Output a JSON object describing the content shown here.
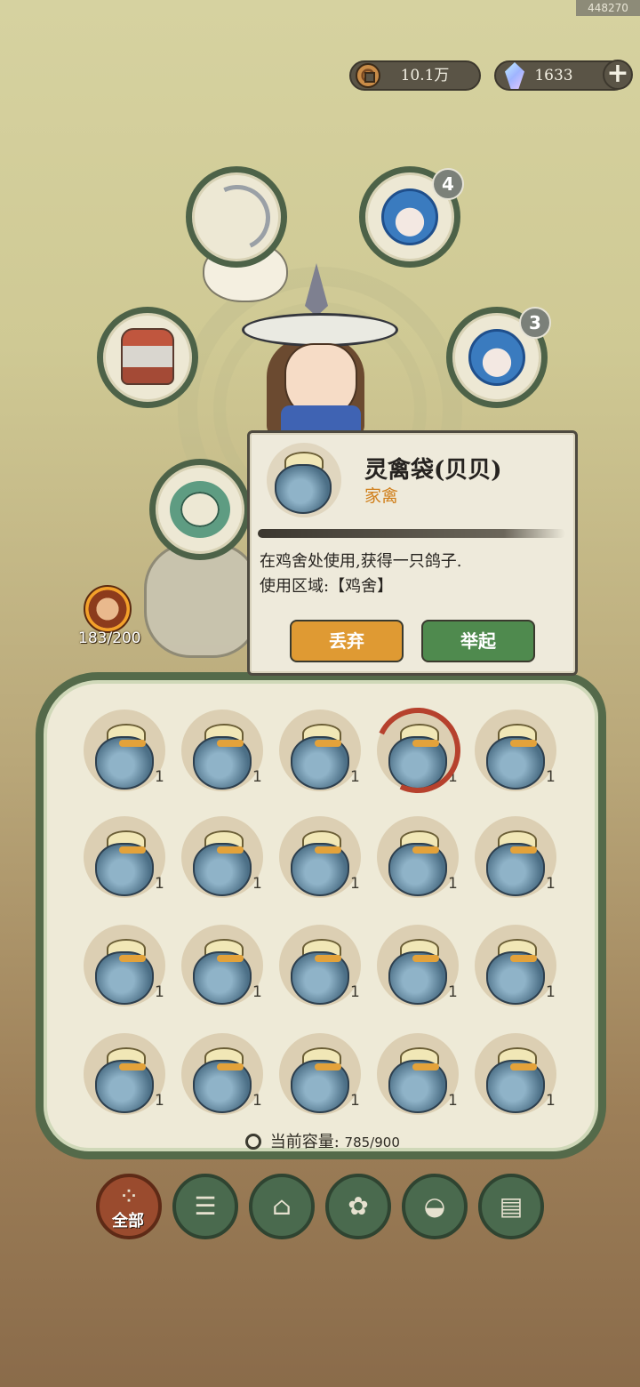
{
  "top": {
    "uid": "448270"
  },
  "currency": {
    "coins": "10.1万",
    "gems": "1633",
    "plus": "+"
  },
  "equipment": {
    "pet1_badge": "4",
    "pet2_badge": "3"
  },
  "energy": {
    "value": "183/200"
  },
  "tooltip": {
    "name": "灵禽袋(贝贝)",
    "type": "家禽",
    "desc_line1": "在鸡舍处使用,获得一只鸽子.",
    "desc_line2": "使用区域:【鸡舍】",
    "discard_label": "丢弃",
    "lift_label": "举起"
  },
  "inventory": {
    "item_name": "灵禽袋(贝贝)",
    "quantities": [
      "1",
      "1",
      "1",
      "1",
      "1",
      "1",
      "1",
      "1",
      "1",
      "1",
      "1",
      "1",
      "1",
      "1",
      "1",
      "1",
      "1",
      "1",
      "1",
      "1"
    ],
    "selected_index": 3,
    "capacity_label": "当前容量:",
    "capacity_value": "785/900"
  },
  "tabs": [
    {
      "name": "all",
      "label": "全部",
      "icon": "grid-icon",
      "active": true
    },
    {
      "name": "wood",
      "icon": "log-icon"
    },
    {
      "name": "building",
      "icon": "house-icon"
    },
    {
      "name": "herb",
      "icon": "leaf-icon"
    },
    {
      "name": "food",
      "icon": "rice-bowl-icon"
    },
    {
      "name": "scroll",
      "icon": "scroll-icon"
    }
  ],
  "colors": {
    "panel_border": "#546a4a",
    "type_orange": "#d07f1b",
    "discard_button": "#df9a33",
    "lift_button": "#4f8a4e",
    "active_tab": "#9a4b2e"
  }
}
